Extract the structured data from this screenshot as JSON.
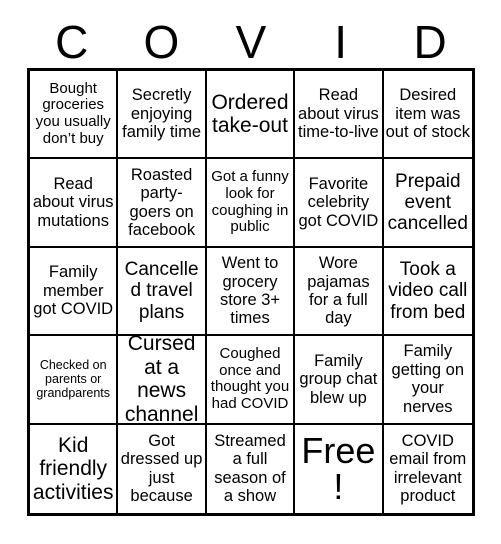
{
  "header": {
    "letters": [
      "C",
      "O",
      "V",
      "I",
      "D"
    ]
  },
  "grid": {
    "rows": 5,
    "columns": 5,
    "cells": [
      {
        "text": "Bought groceries you usually don’t buy",
        "size": "fs-sm"
      },
      {
        "text": "Secretly enjoying family time",
        "size": "fs-md"
      },
      {
        "text": "Ordered take-out",
        "size": "fs-xl"
      },
      {
        "text": "Read about virus time-to-live",
        "size": "fs-md"
      },
      {
        "text": "Desired item was out of stock",
        "size": "fs-md"
      },
      {
        "text": "Read about virus mutations",
        "size": "fs-md"
      },
      {
        "text": "Roasted party-goers on facebook",
        "size": "fs-md"
      },
      {
        "text": "Got a funny look for coughing in public",
        "size": "fs-sm"
      },
      {
        "text": "Favorite celebrity got COVID",
        "size": "fs-md"
      },
      {
        "text": "Prepaid event cancelled",
        "size": "fs-lg"
      },
      {
        "text": "Family member got COVID",
        "size": "fs-md"
      },
      {
        "text": "Cancelled travel plans",
        "size": "fs-lg"
      },
      {
        "text": "Went to grocery store 3+ times",
        "size": "fs-md"
      },
      {
        "text": "Wore pajamas for a full day",
        "size": "fs-md"
      },
      {
        "text": "Took a video call from bed",
        "size": "fs-lg"
      },
      {
        "text": "Checked on parents or grandparents",
        "size": "fs-xs"
      },
      {
        "text": "Cursed at a news channel",
        "size": "fs-xl"
      },
      {
        "text": "Coughed once and thought you had COVID",
        "size": "fs-sm"
      },
      {
        "text": "Family group chat blew up",
        "size": "fs-md"
      },
      {
        "text": "Family getting on your nerves",
        "size": "fs-md"
      },
      {
        "text": "Kid friendly activities",
        "size": "fs-xl"
      },
      {
        "text": "Got dressed up just because",
        "size": "fs-md"
      },
      {
        "text": "Streamed a full season of a show",
        "size": "fs-md"
      },
      {
        "text": "Free!",
        "size": "fs-free"
      },
      {
        "text": "COVID email from irrelevant product",
        "size": "fs-md"
      }
    ]
  },
  "colors": {
    "background": "#ffffff",
    "text": "#000000",
    "border": "#000000"
  }
}
